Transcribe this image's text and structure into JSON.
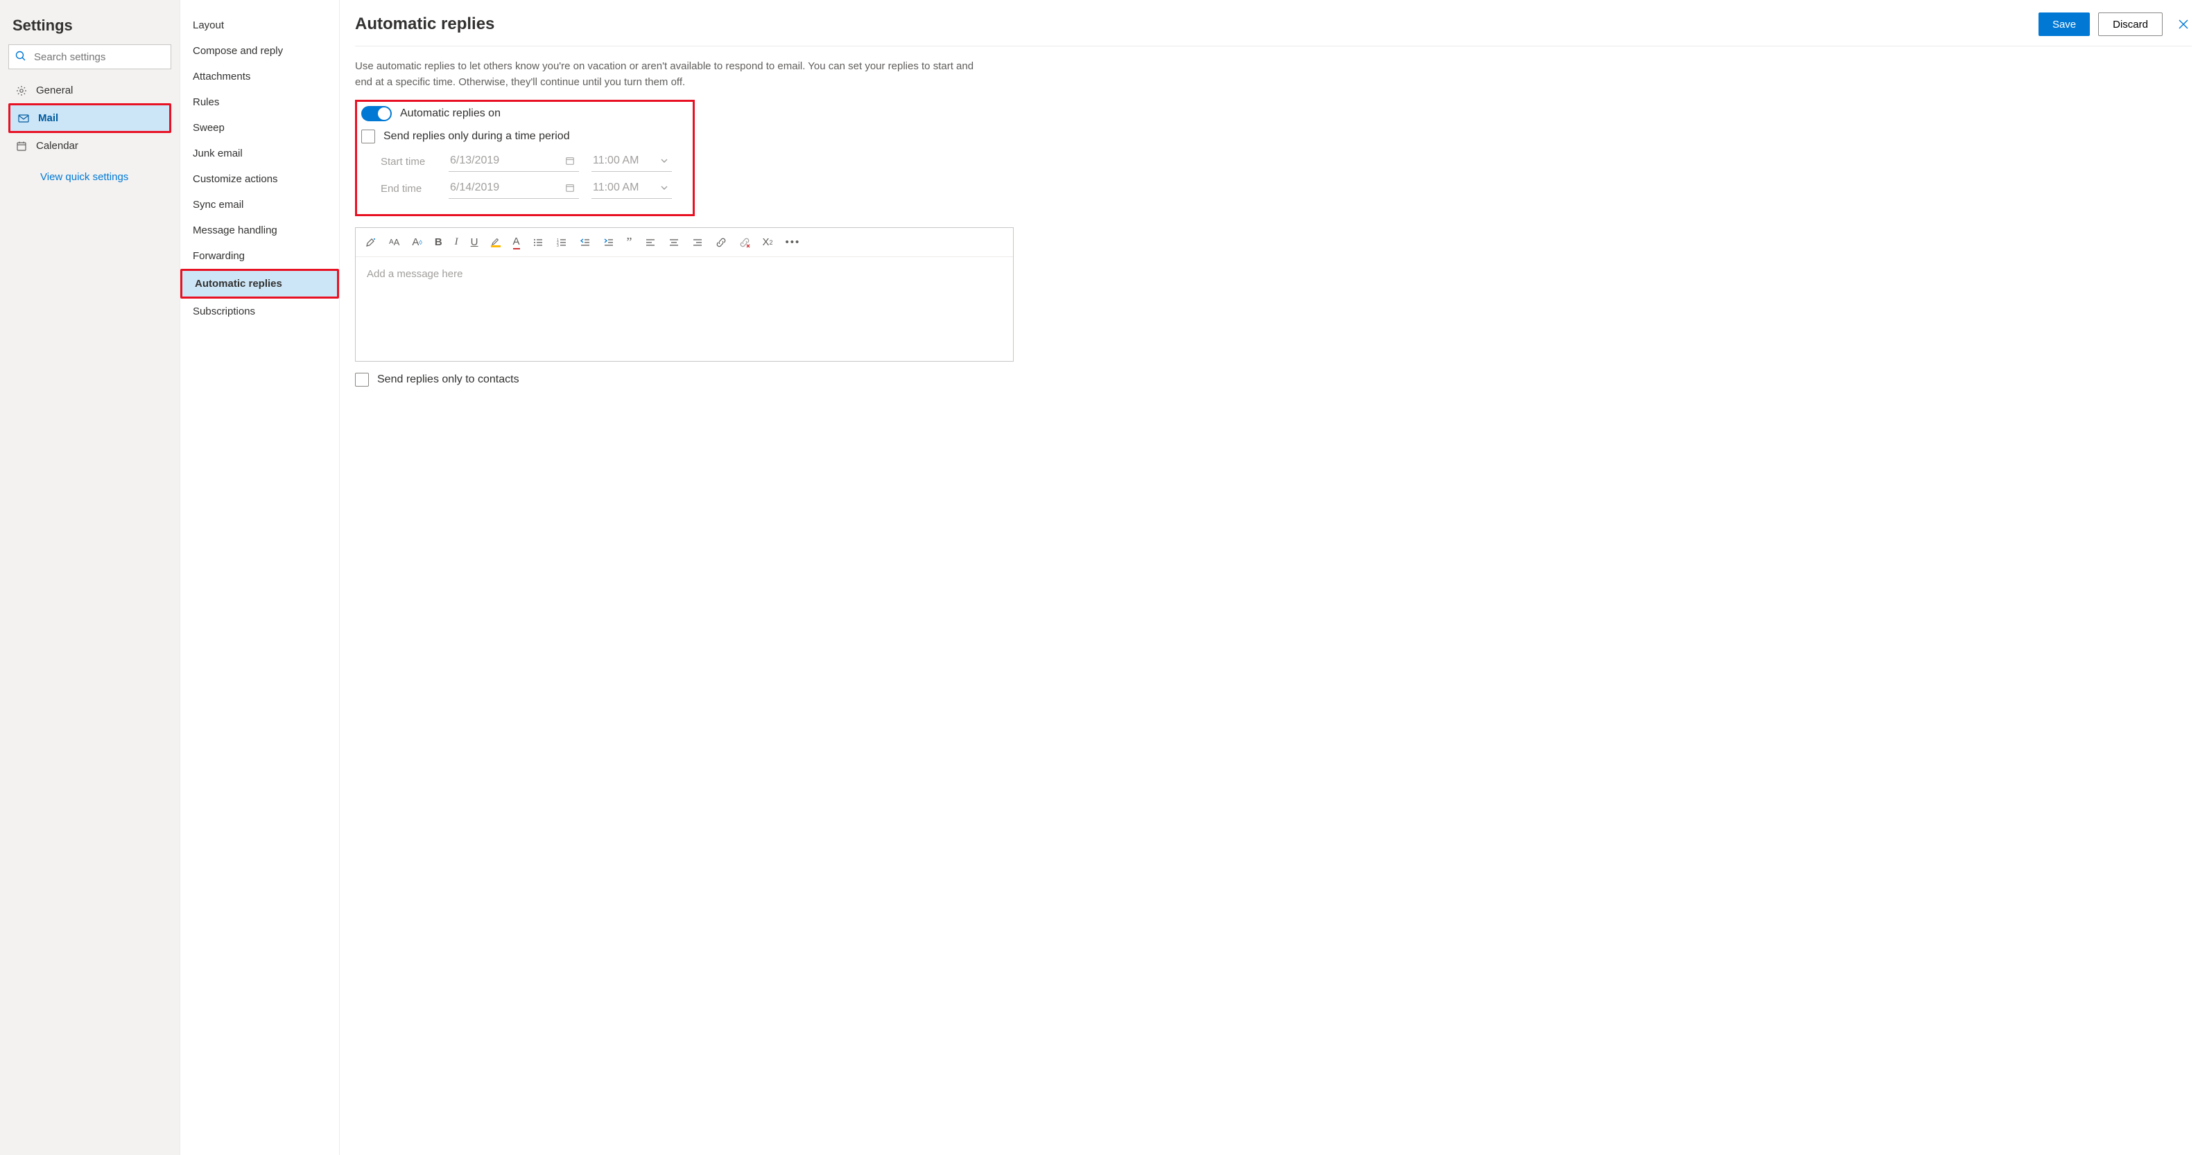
{
  "sidebar": {
    "title": "Settings",
    "search_placeholder": "Search settings",
    "items": [
      {
        "label": "General"
      },
      {
        "label": "Mail"
      },
      {
        "label": "Calendar"
      }
    ],
    "quick_link": "View quick settings"
  },
  "subnav": {
    "items": [
      "Layout",
      "Compose and reply",
      "Attachments",
      "Rules",
      "Sweep",
      "Junk email",
      "Customize actions",
      "Sync email",
      "Message handling",
      "Forwarding",
      "Automatic replies",
      "Subscriptions"
    ]
  },
  "main": {
    "title": "Automatic replies",
    "save": "Save",
    "discard": "Discard",
    "description": "Use automatic replies to let others know you're on vacation or aren't available to respond to email. You can set your replies to start and end at a specific time. Otherwise, they'll continue until you turn them off.",
    "toggle_label": "Automatic replies on",
    "time_period_label": "Send replies only during a time period",
    "start_label": "Start time",
    "start_date": "6/13/2019",
    "start_time": "11:00 AM",
    "end_label": "End time",
    "end_date": "6/14/2019",
    "end_time": "11:00 AM",
    "editor_placeholder": "Add a message here",
    "contacts_only_label": "Send replies only to contacts"
  }
}
